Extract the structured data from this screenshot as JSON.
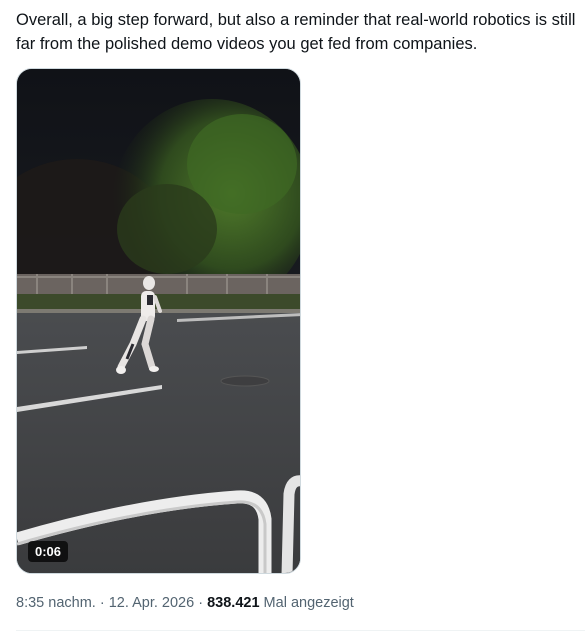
{
  "tweet": {
    "text": "Overall, a big step forward, but also a reminder that real-world robotics is still far from the polished demo videos you get fed from companies."
  },
  "media": {
    "type": "video",
    "duration": "0:06",
    "icons": {
      "robot": "robot-figure-icon"
    }
  },
  "meta": {
    "time": "8:35 nachm.",
    "separator": "·",
    "date": "12. Apr. 2026",
    "views_count": "838.421",
    "views_label": "Mal angezeigt"
  },
  "colors": {
    "text": "#0f1419",
    "secondary": "#536471",
    "border": "#cfd9de"
  }
}
